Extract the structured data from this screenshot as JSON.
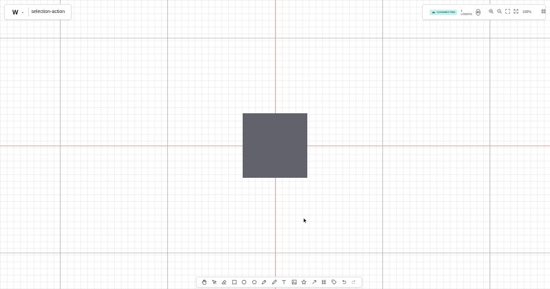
{
  "board": {
    "logo": "W",
    "name": "selection-action"
  },
  "status": {
    "connection": "CONNECTED",
    "users": "1 USERS",
    "avatar_initials": "JC",
    "zoom": "100%"
  },
  "canvas": {
    "shape_fill": "#62626c",
    "axis_color": "#e7a3a8"
  },
  "toolbar": {
    "tools": [
      "hand",
      "select",
      "eraser",
      "rectangle",
      "ellipse",
      "polygon",
      "pen",
      "pencil",
      "text",
      "image",
      "star",
      "arrow",
      "frame",
      "tag",
      "undo",
      "redo"
    ]
  }
}
